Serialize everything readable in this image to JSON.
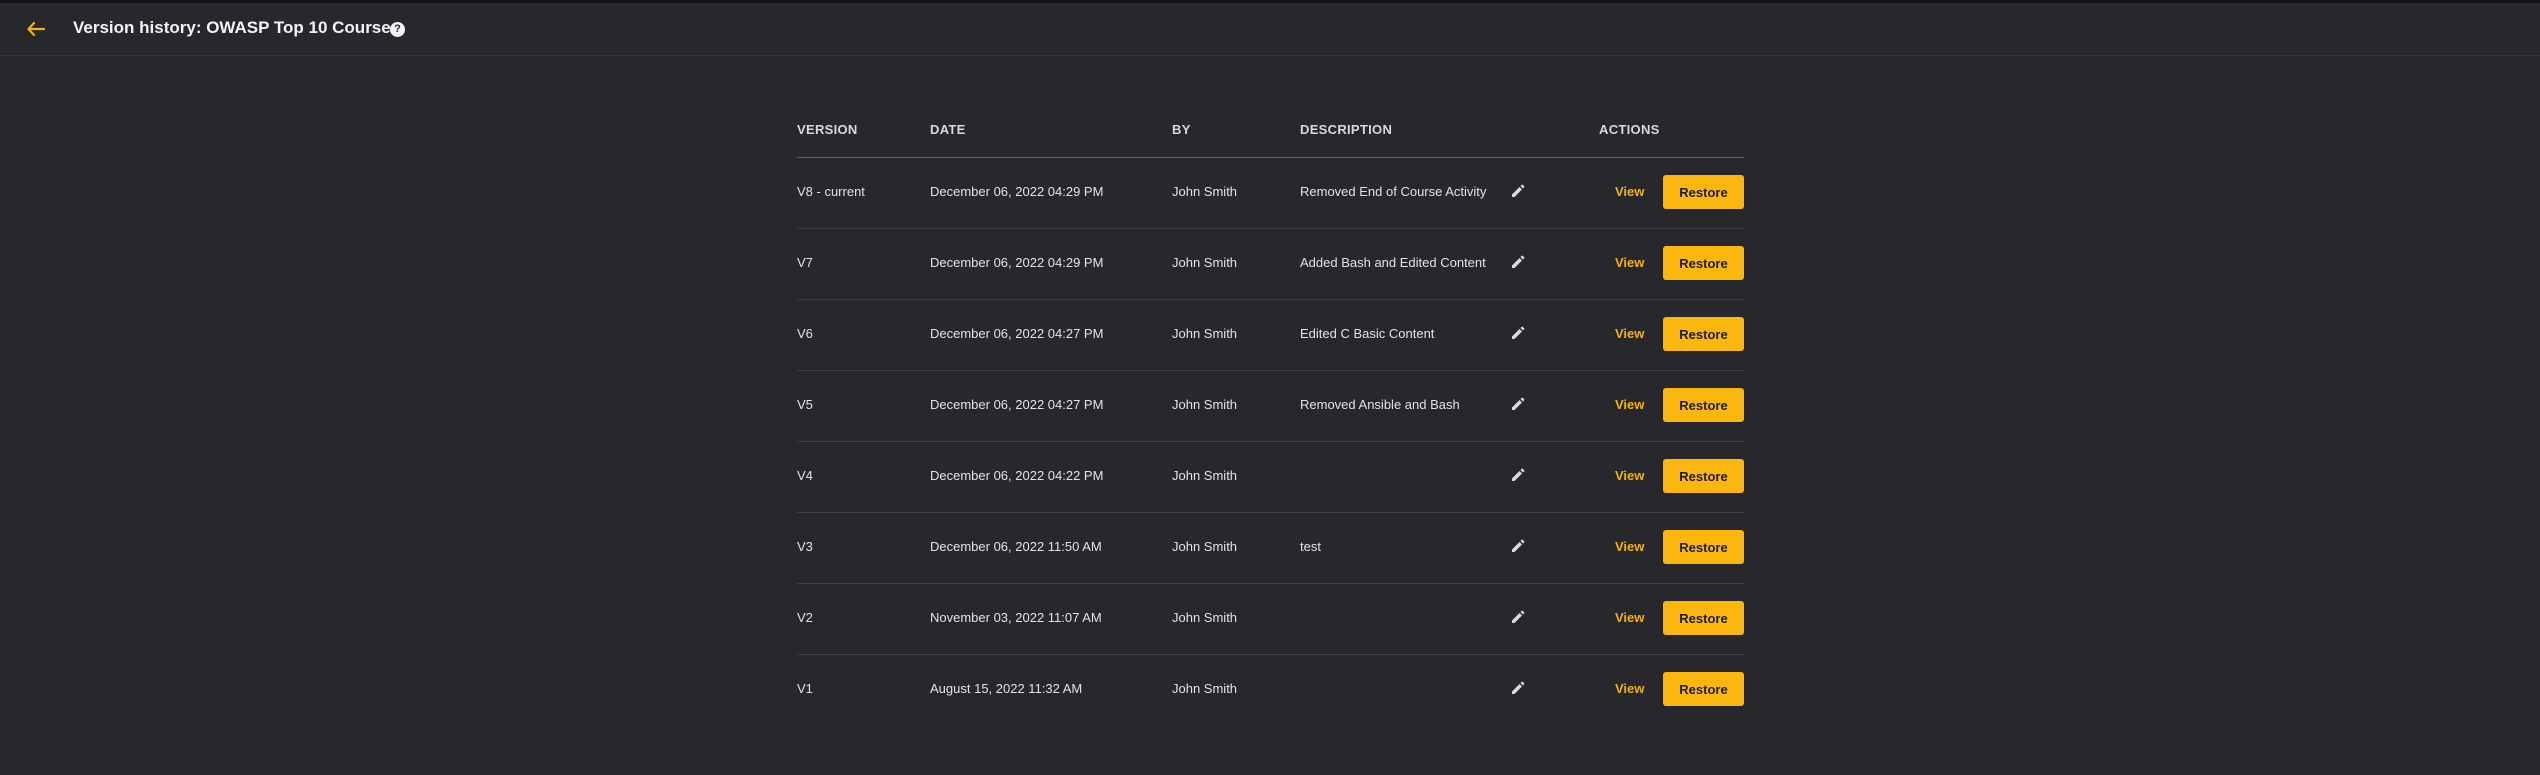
{
  "header": {
    "title": "Version history: OWASP Top 10 Course",
    "back_icon": "arrow-left-icon",
    "help_icon": "question-circle-icon",
    "help_glyph": "?",
    "accent_color": "#f5b20d"
  },
  "table": {
    "columns": {
      "version": "VERSION",
      "date": "DATE",
      "by": "BY",
      "description": "DESCRIPTION",
      "actions": "ACTIONS"
    },
    "view_label": "View",
    "restore_label": "Restore",
    "edit_icon": "pencil-icon",
    "rows": [
      {
        "version": "V8 - current",
        "date": "December 06, 2022 04:29 PM",
        "by": "John Smith",
        "description": "Removed End of Course Activity"
      },
      {
        "version": "V7",
        "date": "December 06, 2022 04:29 PM",
        "by": "John Smith",
        "description": "Added Bash and Edited Content"
      },
      {
        "version": "V6",
        "date": "December 06, 2022 04:27 PM",
        "by": "John Smith",
        "description": "Edited C Basic Content"
      },
      {
        "version": "V5",
        "date": "December 06, 2022 04:27 PM",
        "by": "John Smith",
        "description": "Removed Ansible and Bash"
      },
      {
        "version": "V4",
        "date": "December 06, 2022 04:22 PM",
        "by": "John Smith",
        "description": ""
      },
      {
        "version": "V3",
        "date": "December 06, 2022 11:50 AM",
        "by": "John Smith",
        "description": "test"
      },
      {
        "version": "V2",
        "date": "November 03, 2022 11:07 AM",
        "by": "John Smith",
        "description": ""
      },
      {
        "version": "V1",
        "date": "August 15, 2022 11:32 AM",
        "by": "John Smith",
        "description": ""
      }
    ]
  }
}
